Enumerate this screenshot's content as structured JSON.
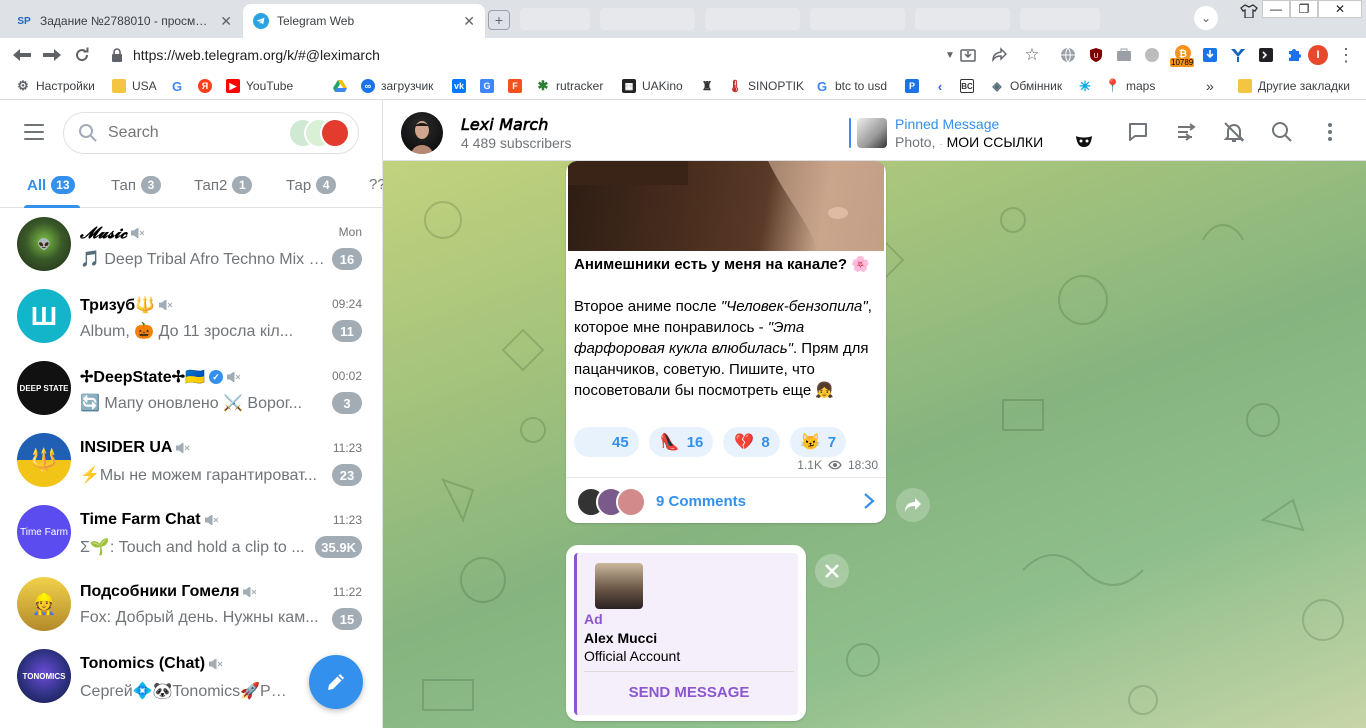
{
  "browser": {
    "tabs": [
      {
        "favicon_text": "SP",
        "title": "Задание №2788010 - просмотр за",
        "active": false
      },
      {
        "favicon_text": "",
        "title": "Telegram Web",
        "active": true
      }
    ],
    "url": "https://web.telegram.org/k/#@lexi march",
    "url_display": "https://web.telegram.org/k/#@leximarch",
    "profile_initial": "I",
    "ext_badge": "10789",
    "bookmarks": [
      {
        "label": "Настройки",
        "icon": "gear-icon",
        "color": "#5f6368"
      },
      {
        "label": "USA",
        "icon": "folder-icon",
        "color": "#f4c542"
      },
      {
        "label": "",
        "icon": "google-icon",
        "color": "#4285f4"
      },
      {
        "label": "",
        "icon": "yandex-icon",
        "color": "#fc3f1d"
      },
      {
        "label": "YouTube",
        "icon": "youtube-icon",
        "color": "#ff0000"
      },
      {
        "label": "",
        "icon": "drive-icon",
        "color": "#1fa463"
      },
      {
        "label": "загрузчик",
        "icon": "infinity-icon",
        "color": "#1a73e8"
      },
      {
        "label": "",
        "icon": "vk-icon",
        "color": "#0077ff"
      },
      {
        "label": "",
        "icon": "translate-icon",
        "color": "#4285f4"
      },
      {
        "label": "",
        "icon": "f-icon",
        "color": "#f4511e"
      },
      {
        "label": "rutracker",
        "icon": "rutracker-icon",
        "color": "#2e7d32"
      },
      {
        "label": "UAKino",
        "icon": "uakino-icon",
        "color": "#222222"
      },
      {
        "label": "",
        "icon": "bottle-icon",
        "color": "#333333"
      },
      {
        "label": "SINOPTIK",
        "icon": "thermometer-icon",
        "color": "#c62828"
      },
      {
        "label": "btc to usd",
        "icon": "google-icon",
        "color": "#4285f4"
      },
      {
        "label": "",
        "icon": "p-icon",
        "color": "#1a73e8"
      },
      {
        "label": "",
        "icon": "arrow-icon",
        "color": "#3d5afe"
      },
      {
        "label": "",
        "icon": "bc-icon",
        "color": "#333333"
      },
      {
        "label": "Обмінник",
        "icon": "exchange-icon",
        "color": "#546e7a"
      },
      {
        "label": "",
        "icon": "star-icon",
        "color": "#00a9e0"
      },
      {
        "label": "maps",
        "icon": "maps-icon",
        "color": "#34a853"
      }
    ],
    "other_bookmarks": "Другие закладки",
    "more": "»"
  },
  "telegram": {
    "search": {
      "placeholder": "Search"
    },
    "folders": [
      {
        "label": "All",
        "count": "13",
        "active": true
      },
      {
        "label": "Тап",
        "count": "3",
        "active": false
      },
      {
        "label": "Тап2",
        "count": "1",
        "active": false
      },
      {
        "label": "Тар",
        "count": "4",
        "active": false
      },
      {
        "label": "??",
        "count": "",
        "active": false
      }
    ],
    "chats": [
      {
        "name": "𝓜𝓾𝓼𝓲𝓬",
        "time": "Mon",
        "preview": "🎵 Deep Tribal Afro Techno Mix -...",
        "unread": "16",
        "avatar_color": "#3b5a2a"
      },
      {
        "name": "Тризуб🔱",
        "time": "09:24",
        "preview": "Album, 🎃 До 11 зросла кіл...",
        "unread": "11",
        "avatar_color": "#12b5c9"
      },
      {
        "name": "✢DeepState✢🇺🇦",
        "time": "00:02",
        "preview": "🔄 Мапу оновлено ⚔️ Ворог...",
        "unread": "3",
        "avatar_color": "#111111"
      },
      {
        "name": "INSIDER UA",
        "time": "11:23",
        "preview": "⚡Мы не можем гарантироват...",
        "unread": "23",
        "avatar_color": "#1f5fb4"
      },
      {
        "name": "Time Farm Chat",
        "time": "11:23",
        "preview": "Σ🌱: Touch and hold a clip to ...",
        "unread": "35.9K",
        "avatar_color": "#5b4cf0"
      },
      {
        "name": "Подсобники Гомеля",
        "time": "11:22",
        "preview": "Fox: Добрый день. Нужны кам...",
        "unread": "15",
        "avatar_color": "#d7b33b"
      },
      {
        "name": "Tonomics (Chat)",
        "time": "",
        "preview": "Сергей💠🐼Tonomics🚀Pand...",
        "unread": "",
        "avatar_color": "#2a2f7a"
      }
    ],
    "channel": {
      "name": "𝘓𝘦𝘹𝘪 𝘔𝘢𝘳𝘤𝘩",
      "subscribers": "4 489 subscribers",
      "pinned_label": "Pinned Message",
      "pinned_text_prefix": "Photo,",
      "pinned_text": "МОИ ССЫЛКИ"
    },
    "post": {
      "line1": "Анимешники есть у меня на канале? 🌸",
      "p2_a": "Второе аниме после ",
      "p2_q1": "\"Человек-бензопила\"",
      "p2_b": ", которое мне понравилось  - ",
      "p2_q2": "\"Эта фарфоровая кукла влюбилась\"",
      "p2_c": ". Прям для пацанчиков, советую. Пишите, что посоветовали бы посмотреть еще 👧",
      "reactions": [
        {
          "emoji": "",
          "count": "45"
        },
        {
          "emoji": "👠",
          "count": "16"
        },
        {
          "emoji": "💔",
          "count": "8"
        },
        {
          "emoji": "😼",
          "count": "7"
        }
      ],
      "views": "1.1K",
      "time": "18:30",
      "comments": "9 Comments"
    },
    "ad": {
      "label": "Ad",
      "name": "Alex Mucci",
      "description": "Official Account",
      "button": "SEND MESSAGE"
    }
  }
}
